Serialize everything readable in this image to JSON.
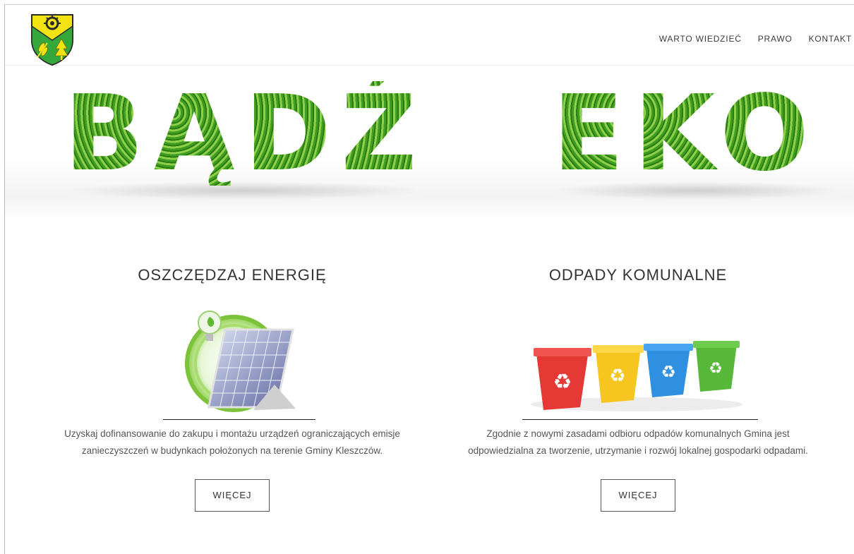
{
  "nav": {
    "items": [
      "WARTO WIEDZIEĆ",
      "PRAWO",
      "KONTAKT"
    ]
  },
  "hero": {
    "left_word": "BĄDŹ",
    "right_word": "EKO"
  },
  "columns": [
    {
      "title": "OSZCZĘDZAJ ENERGIĘ",
      "text": "Uzyskaj dofinansowanie do zakupu i montażu urządzeń ograniczających emisje zanieczyszczeń w budynkach położonych na terenie Gminy Kleszczów.",
      "button": "WIĘCEJ"
    },
    {
      "title": "ODPADY KOMUNALNE",
      "text": "Zgodnie z nowymi zasadami odbioru odpadów komunalnych Gmina jest odpowiedzialna za tworzenie, utrzymanie i rozwój lokalnej gospodarki odpadami.",
      "button": "WIĘCEJ"
    }
  ],
  "colors": {
    "leaf_green": "#3f9e22",
    "bin_red": "#e53935",
    "bin_yellow": "#f7c520",
    "bin_blue": "#2f8fe0",
    "bin_green": "#58b83a"
  }
}
